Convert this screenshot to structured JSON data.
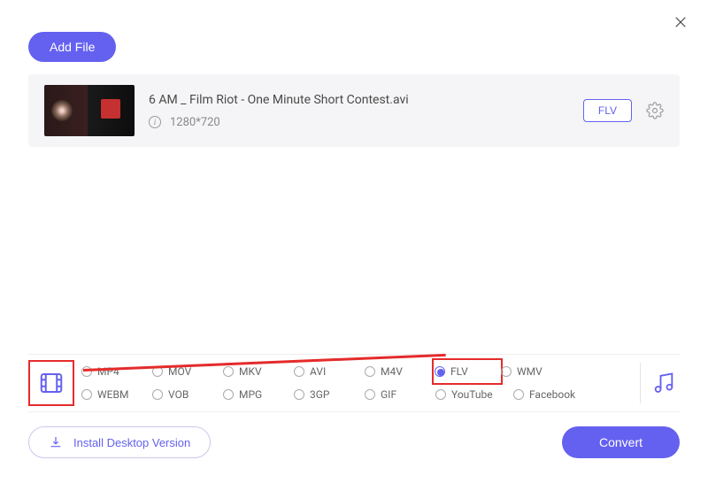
{
  "header": {
    "add_file_label": "Add File"
  },
  "file": {
    "name": "6 AM _ Film Riot - One Minute Short Contest.avi",
    "resolution": "1280*720",
    "format_badge": "FLV"
  },
  "formats": {
    "row1": [
      {
        "key": "mp4",
        "label": "MP4",
        "checked": false
      },
      {
        "key": "mov",
        "label": "MOV",
        "checked": false
      },
      {
        "key": "mkv",
        "label": "MKV",
        "checked": false
      },
      {
        "key": "avi",
        "label": "AVI",
        "checked": false
      },
      {
        "key": "m4v",
        "label": "M4V",
        "checked": false
      },
      {
        "key": "flv",
        "label": "FLV",
        "checked": true
      },
      {
        "key": "wmv",
        "label": "WMV",
        "checked": false
      }
    ],
    "row2": [
      {
        "key": "webm",
        "label": "WEBM",
        "checked": false
      },
      {
        "key": "vob",
        "label": "VOB",
        "checked": false
      },
      {
        "key": "mpg",
        "label": "MPG",
        "checked": false
      },
      {
        "key": "3gp",
        "label": "3GP",
        "checked": false
      },
      {
        "key": "gif",
        "label": "GIF",
        "checked": false
      },
      {
        "key": "youtube",
        "label": "YouTube",
        "checked": false
      },
      {
        "key": "facebook",
        "label": "Facebook",
        "checked": false
      }
    ]
  },
  "footer": {
    "install_label": "Install Desktop Version",
    "convert_label": "Convert"
  }
}
